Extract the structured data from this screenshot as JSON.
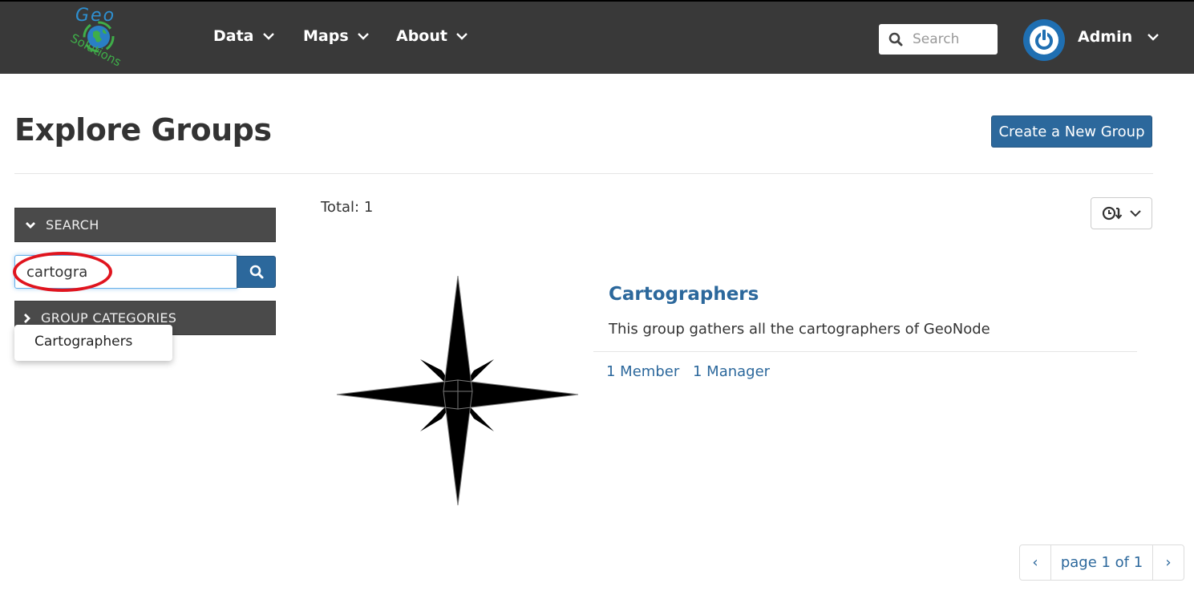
{
  "header": {
    "logo_text_top": "Geo",
    "logo_text_bottom": "Solutions",
    "nav": [
      {
        "label": "Data"
      },
      {
        "label": "Maps"
      },
      {
        "label": "About"
      }
    ],
    "search_placeholder": "Search",
    "user_label": "Admin"
  },
  "page": {
    "title": "Explore Groups",
    "create_button": "Create a New Group"
  },
  "sidebar": {
    "search_heading": "SEARCH",
    "search_value": "cartogra",
    "categories_heading": "GROUP CATEGORIES",
    "suggestion": "Cartographers"
  },
  "results": {
    "total": "Total: 1",
    "group": {
      "title": "Cartographers",
      "description": "This group gathers all the cartographers of GeoNode",
      "members": "1 Member",
      "managers": "1 Manager"
    }
  },
  "pagination": {
    "prev": "‹",
    "label": "page 1 of 1",
    "next": "›"
  },
  "colors": {
    "topbar": "#393939",
    "primary": "#2c689c",
    "panel": "#4a4a4a",
    "highlight_oval": "#e0141e"
  },
  "icons": [
    "geo-solutions-logo",
    "chevron-down-icon",
    "search-icon",
    "power-icon",
    "clock-sort-icon",
    "compass-rose-image"
  ]
}
